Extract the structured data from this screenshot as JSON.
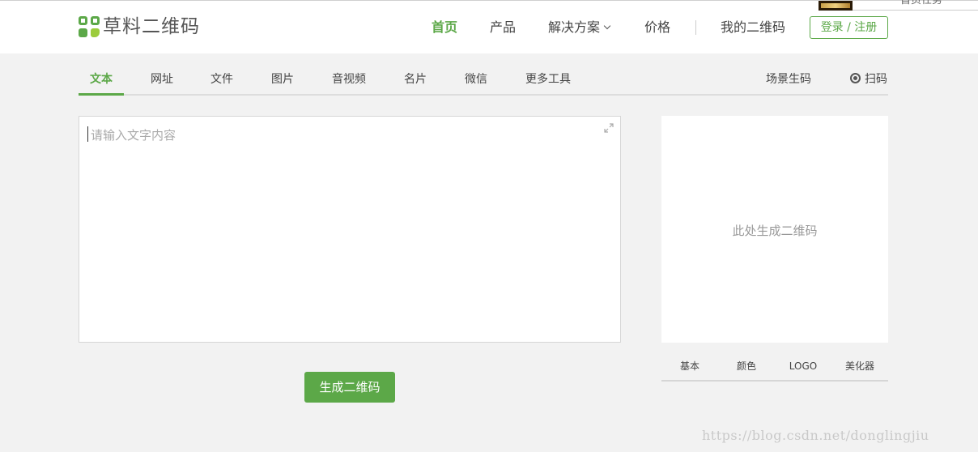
{
  "header": {
    "logo_text": "草料二维码",
    "nav": [
      {
        "label": "首页",
        "active": true
      },
      {
        "label": "产品"
      },
      {
        "label": "解决方案"
      },
      {
        "label": "价格"
      },
      {
        "label": "我的二维码"
      }
    ],
    "login_label": "登录 / 注册",
    "corner_text": "首页任务"
  },
  "tabs": {
    "items": [
      "文本",
      "网址",
      "文件",
      "图片",
      "音视频",
      "名片",
      "微信",
      "更多工具"
    ],
    "active": "文本",
    "right": [
      "场景生码",
      "扫码"
    ]
  },
  "editor": {
    "placeholder": "请输入文字内容",
    "generate_label": "生成二维码"
  },
  "preview": {
    "placeholder": "此处生成二维码",
    "style_tabs": [
      "基本",
      "颜色",
      "LOGO",
      "美化器"
    ]
  },
  "watermark": "https://blog.csdn.net/donglingjiu",
  "colors": {
    "accent": "#5ca848",
    "background": "#f2f2f2"
  }
}
